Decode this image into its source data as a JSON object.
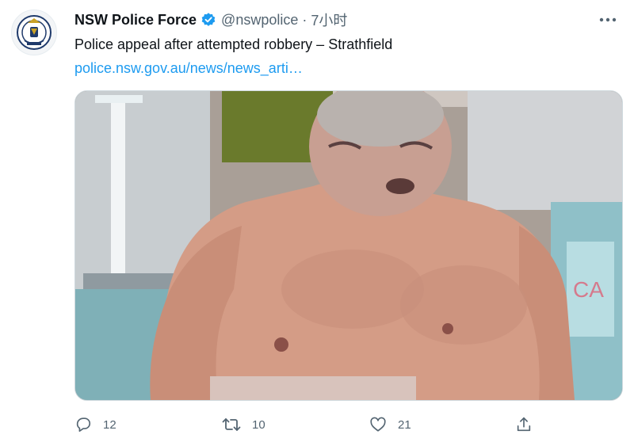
{
  "account": {
    "display_name": "NSW Police Force",
    "handle": "@nswpolice",
    "separator": "·",
    "time": "7小时"
  },
  "tweet": {
    "text": "Police appeal after attempted robbery – Strathfield",
    "link": "police.nsw.gov.au/news/news_arti…"
  },
  "actions": {
    "reply_count": "12",
    "retweet_count": "10",
    "like_count": "21"
  },
  "icons": {
    "verified": "verified-badge-icon",
    "more": "more-horizontal-icon",
    "reply": "reply-icon",
    "retweet": "retweet-icon",
    "like": "heart-icon",
    "share": "share-icon"
  },
  "colors": {
    "link": "#1d9bf0",
    "verified": "#1d9bf0",
    "muted": "#536471"
  }
}
